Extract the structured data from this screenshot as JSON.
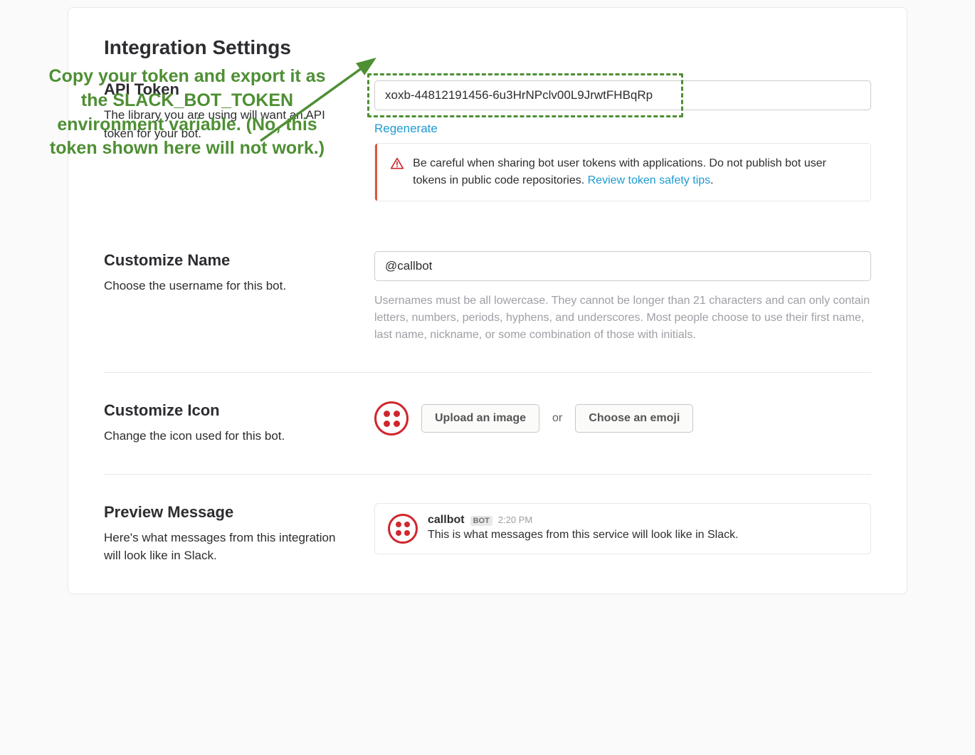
{
  "page": {
    "title": "Integration Settings"
  },
  "apiToken": {
    "heading": "API Token",
    "description": "The library you are using will want an API token for your bot.",
    "value": "xoxb-44812191456-6u3HrNPclv00L9JrwtFHBqRp",
    "regenerateLabel": "Regenerate",
    "warning": {
      "text": "Be careful when sharing bot user tokens with applications. Do not publish bot user tokens in public code repositories. ",
      "linkText": "Review token safety tips",
      "after": "."
    }
  },
  "annotation": {
    "text": "Copy your token and export it as the SLACK_BOT_TOKEN environment variable. (No, this token shown here will not work.)"
  },
  "customizeName": {
    "heading": "Customize Name",
    "description": "Choose the username for this bot.",
    "value": "@callbot",
    "hint": "Usernames must be all lowercase. They cannot be longer than 21 characters and can only contain letters, numbers, periods, hyphens, and underscores. Most people choose to use their first name, last name, nickname, or some combination of those with initials."
  },
  "customizeIcon": {
    "heading": "Customize Icon",
    "description": "Change the icon used for this bot.",
    "uploadLabel": "Upload an image",
    "orLabel": "or",
    "emojiLabel": "Choose an emoji"
  },
  "preview": {
    "heading": "Preview Message",
    "description": "Here's what messages from this integration will look like in Slack.",
    "botName": "callbot",
    "botBadge": "BOT",
    "time": "2:20 PM",
    "message": "This is what messages from this service will look like in Slack."
  }
}
